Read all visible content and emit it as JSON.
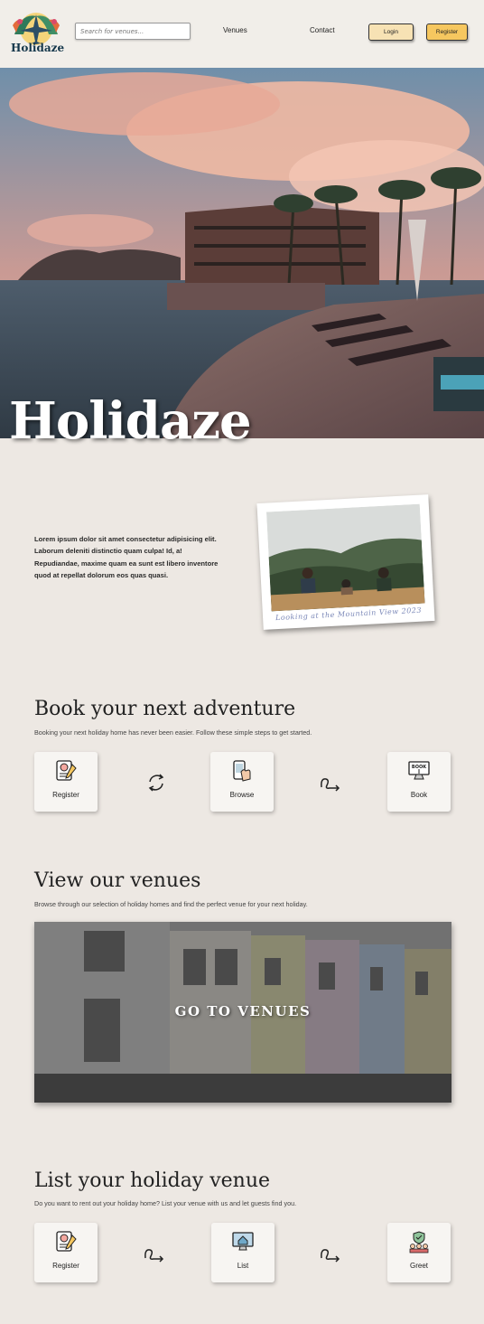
{
  "header": {
    "logo_text": "Holidaze",
    "search_placeholder": "Search for venues...",
    "nav": [
      "Venues",
      "Contact"
    ],
    "login_label": "Login",
    "register_label": "Register"
  },
  "hero": {
    "title": "Holidaze"
  },
  "intro": {
    "text": "Lorem ipsum dolor sit amet consectetur adipisicing elit. Laborum deleniti distinctio quam culpa! Id, a! Repudiandae, maxime quam ea sunt est libero inventore quod at repellat dolorum eos quas quasi.",
    "photo_caption": "Looking at the Mountain View 2023"
  },
  "book": {
    "title": "Book your next adventure",
    "subtitle": "Booking your next holiday home has never been easier. Follow these simple steps to get started.",
    "steps": [
      "Register",
      "Browse",
      "Book"
    ]
  },
  "venues": {
    "title": "View our venues",
    "subtitle": "Browse through our selection of holiday homes and find the perfect venue for your next holiday.",
    "cta": "GO TO VENUES"
  },
  "list": {
    "title": "List your holiday venue",
    "subtitle": "Do you want to rent out your holiday home? List your venue with us and let guests find you.",
    "steps": [
      "Register",
      "List",
      "Greet"
    ]
  },
  "colors": {
    "background": "#ede8e3",
    "header": "#f1eee9",
    "register_button": "#f6c75f",
    "login_button": "#f7e2b4"
  }
}
